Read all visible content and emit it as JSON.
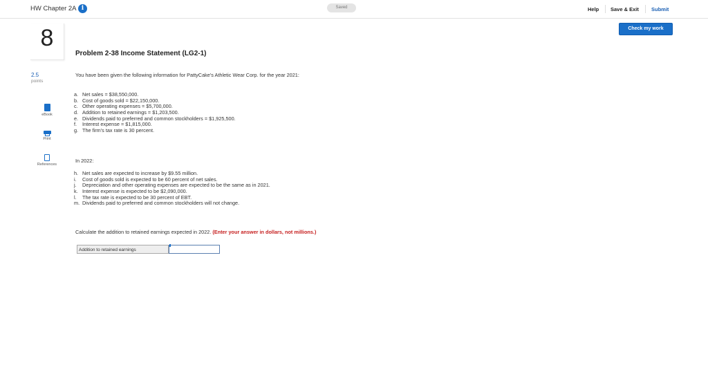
{
  "header": {
    "title": "HW Chapter 2A",
    "info_icon": "i",
    "saved_label": "Saved",
    "help_label": "Help",
    "save_exit_label": "Save & Exit",
    "submit_label": "Submit",
    "check_work_label": "Check my work"
  },
  "question": {
    "number": "8",
    "points_value": "2.5",
    "points_label": "points",
    "title": "Problem 2-38 Income Statement (LG2-1)",
    "intro": "You have been given the following information for PattyCake's Athletic Wear Corp. for the year 2021:",
    "items_2021": [
      {
        "letter": "a.",
        "text": "Net sales = $38,550,000."
      },
      {
        "letter": "b.",
        "text": "Cost of goods sold = $22,150,000."
      },
      {
        "letter": "c.",
        "text": "Other operating expenses = $5,700,000."
      },
      {
        "letter": "d.",
        "text": "Addition to retained earnings = $1,203,500."
      },
      {
        "letter": "e.",
        "text": "Dividends paid to preferred and common stockholders = $1,925,500."
      },
      {
        "letter": "f.",
        "text": "Interest expense = $1,815,000."
      },
      {
        "letter": "g.",
        "text": "The firm's tax rate is 30 percent."
      }
    ],
    "year2_heading": "In 2022:",
    "items_2022": [
      {
        "letter": "h.",
        "text": "Net sales are expected to increase by $9.55 million."
      },
      {
        "letter": "i.",
        "text": "Cost of goods sold is expected to be 60 percent of net sales."
      },
      {
        "letter": "j.",
        "text": "Depreciation and other operating expenses are expected to be the same as in 2021."
      },
      {
        "letter": "k.",
        "text": "Interest expense is expected to be $2,090,000."
      },
      {
        "letter": "l.",
        "text": "The tax rate is expected to be 30 percent of EBT."
      },
      {
        "letter": "m.",
        "text": "Dividends paid to preferred and common stockholders will not change."
      }
    ],
    "instruction": "Calculate the addition to retained earnings expected in 2022.",
    "instruction_note": "(Enter your answer in dollars, not millions.)",
    "answer_label": "Addition to retained earnings",
    "answer_value": ""
  },
  "sidebar_tools": [
    {
      "label": "eBook",
      "icon": "book-icon"
    },
    {
      "label": "Print",
      "icon": "print-icon"
    },
    {
      "label": "References",
      "icon": "references-icon"
    }
  ],
  "colors": {
    "accent": "#1a6fc8",
    "note": "#c62020"
  }
}
